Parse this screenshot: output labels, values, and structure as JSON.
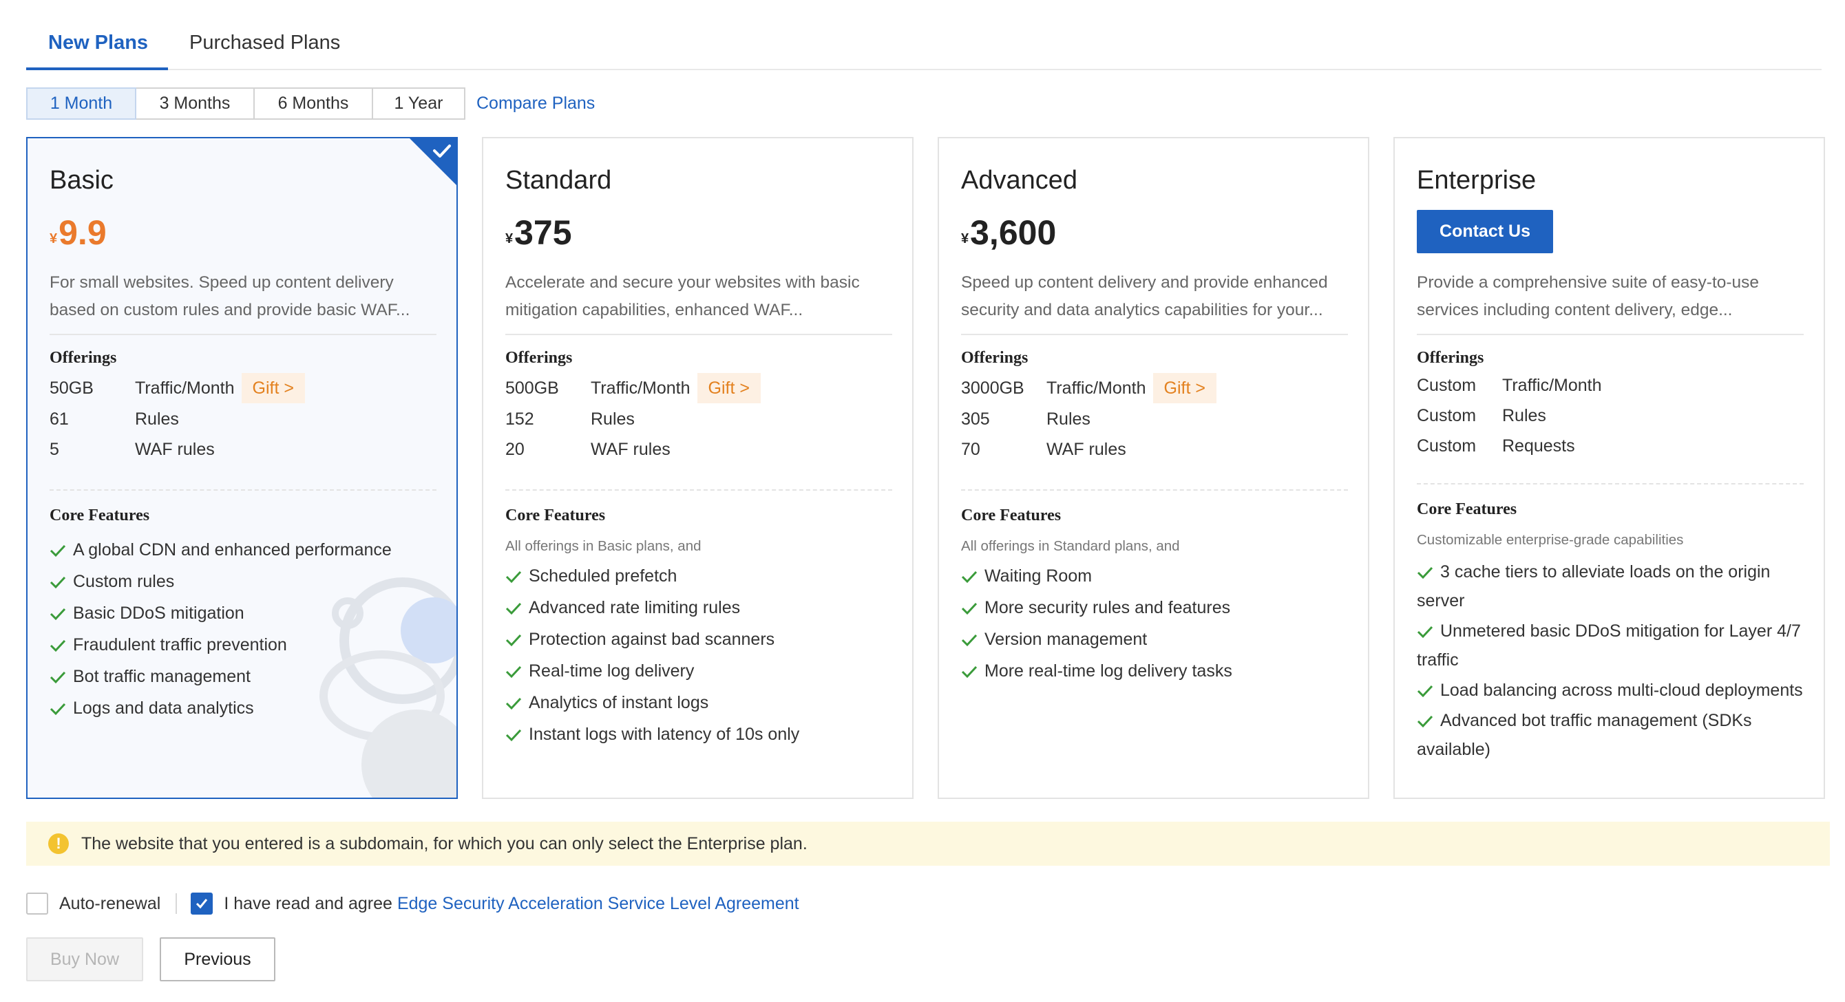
{
  "tabs": [
    {
      "label": "New Plans",
      "active": true
    },
    {
      "label": "Purchased Plans",
      "active": false
    }
  ],
  "periods": [
    {
      "label": "1 Month",
      "active": true
    },
    {
      "label": "3 Months",
      "active": false
    },
    {
      "label": "6 Months",
      "active": false
    },
    {
      "label": "1 Year",
      "active": false
    }
  ],
  "compare_label": "Compare Plans",
  "labels": {
    "offerings": "Offerings",
    "core_features": "Core Features",
    "traffic": "Traffic/Month",
    "rules": "Rules",
    "waf_rules": "WAF rules",
    "requests": "Requests",
    "gift": "Gift >"
  },
  "plans": {
    "basic": {
      "name": "Basic",
      "currency": "¥",
      "price": "9.9",
      "selected": true,
      "desc_line1": "For small websites. Speed up content delivery",
      "desc_line2": "based on custom rules and provide basic WAF...",
      "traffic": "50GB",
      "rules": "61",
      "waf_rules": "5",
      "features": [
        "A global CDN and enhanced performance",
        "Custom rules",
        "Basic DDoS mitigation",
        "Fraudulent traffic prevention",
        "Bot traffic management",
        "Logs and data analytics"
      ]
    },
    "standard": {
      "name": "Standard",
      "currency": "¥",
      "price": "375",
      "desc_line1": "Accelerate and secure your websites with basic",
      "desc_line2": "mitigation capabilities, enhanced WAF...",
      "traffic": "500GB",
      "rules": "152",
      "waf_rules": "20",
      "features_note": "All offerings in Basic plans, and",
      "features": [
        "Scheduled prefetch",
        "Advanced rate limiting rules",
        "Protection against bad scanners",
        "Real-time log delivery",
        "Analytics of instant logs",
        "Instant logs with latency of 10s only"
      ]
    },
    "advanced": {
      "name": "Advanced",
      "currency": "¥",
      "price": "3,600",
      "desc_line1": "Speed up content delivery and provide enhanced",
      "desc_line2": "security and data analytics capabilities for your...",
      "traffic": "3000GB",
      "rules": "305",
      "waf_rules": "70",
      "features_note": "All offerings in Standard plans, and",
      "features": [
        "Waiting Room",
        "More security rules and features",
        "Version management",
        "More real-time log delivery tasks"
      ]
    },
    "enterprise": {
      "name": "Enterprise",
      "contact_label": "Contact Us",
      "desc_line1": "Provide a comprehensive suite of easy-to-use",
      "desc_line2": "services including content delivery, edge...",
      "traffic": "Custom",
      "rules": "Custom",
      "requests": "Custom",
      "features_note": "Customizable enterprise-grade capabilities",
      "features": [
        "3 cache tiers to alleviate loads on the origin server",
        "Unmetered basic DDoS mitigation for Layer 4/7 traffic",
        "Load balancing across multi-cloud deployments",
        "Advanced bot traffic management (SDKs available)"
      ]
    }
  },
  "notice": {
    "icon": "warning-icon",
    "text": "The website that you entered is a subdomain, for which you can only select the Enterprise plan."
  },
  "agreement": {
    "auto_renewal_label": "Auto-renewal",
    "auto_renewal_checked": false,
    "agree_checked": true,
    "agree_text": "I have read and agree",
    "agree_link": "Edge Security Acceleration Service Level Agreement"
  },
  "buttons": {
    "buy_now": "Buy Now",
    "previous": "Previous"
  },
  "colors": {
    "accent": "#1f62c0",
    "price_highlight": "#ea7a2c",
    "gift_text": "#e3811f",
    "gift_bg": "#fdf0e3",
    "check": "#3a9b3a",
    "notice_bg": "#fdf8df"
  }
}
